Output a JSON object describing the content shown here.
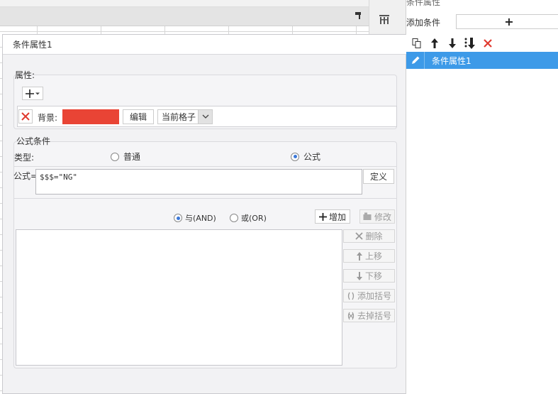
{
  "right_panel": {
    "title": "条件属性",
    "add_condition_label": "添加条件",
    "add_condition_button": "+",
    "items": [
      {
        "label": "条件属性1",
        "selected": true
      }
    ]
  },
  "dialog": {
    "title": "条件属性1",
    "property_section": {
      "title": "属性:",
      "background_label": "背景:",
      "background_color": "#e94435",
      "edit_label": "编辑",
      "scope_value": "当前格子"
    },
    "formula_section": {
      "title": "公式条件",
      "type_label": "类型:",
      "type_normal": "普通",
      "type_formula": "公式",
      "selected_type": "公式",
      "formula_label": "公式=",
      "formula_value": "$$$=\"NG\"",
      "define_label": "定义",
      "and_label": "与(AND)",
      "or_label": "或(OR)",
      "add_label": "增加",
      "modify_label": "修改",
      "delete_label": "删除",
      "move_up_label": "上移",
      "move_down_label": "下移",
      "add_bracket_label": "添加括号",
      "remove_bracket_label": "去掉括号"
    }
  },
  "colors": {
    "accent": "#3d9ae8",
    "danger": "#e03a2f"
  }
}
